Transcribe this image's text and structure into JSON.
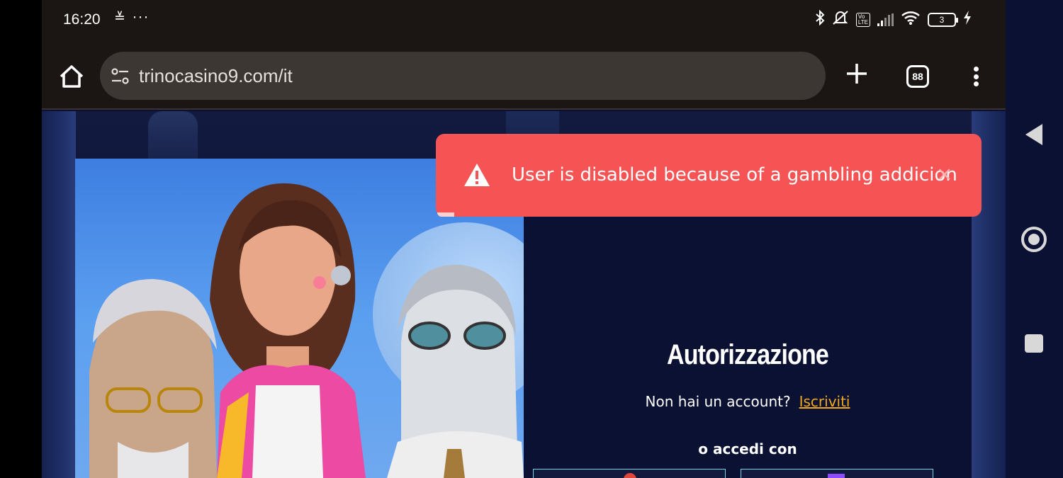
{
  "status_bar": {
    "time": "16:20",
    "left_icons": "≚ ···",
    "battery_level": "3"
  },
  "browser": {
    "url": "trinocasino9.com/it",
    "tab_count": "88"
  },
  "toast": {
    "message": "User is disabled because of a gambling addicion",
    "close_symbol": "×",
    "color": "#f65454"
  },
  "login": {
    "title": "Autorizzazione",
    "no_account_text": "Non hai un account?",
    "signup_link": "Iscriviti",
    "or_login_with": "o accedi con"
  },
  "colors": {
    "page_bg": "#0b1133",
    "accent": "#f0a91a"
  }
}
